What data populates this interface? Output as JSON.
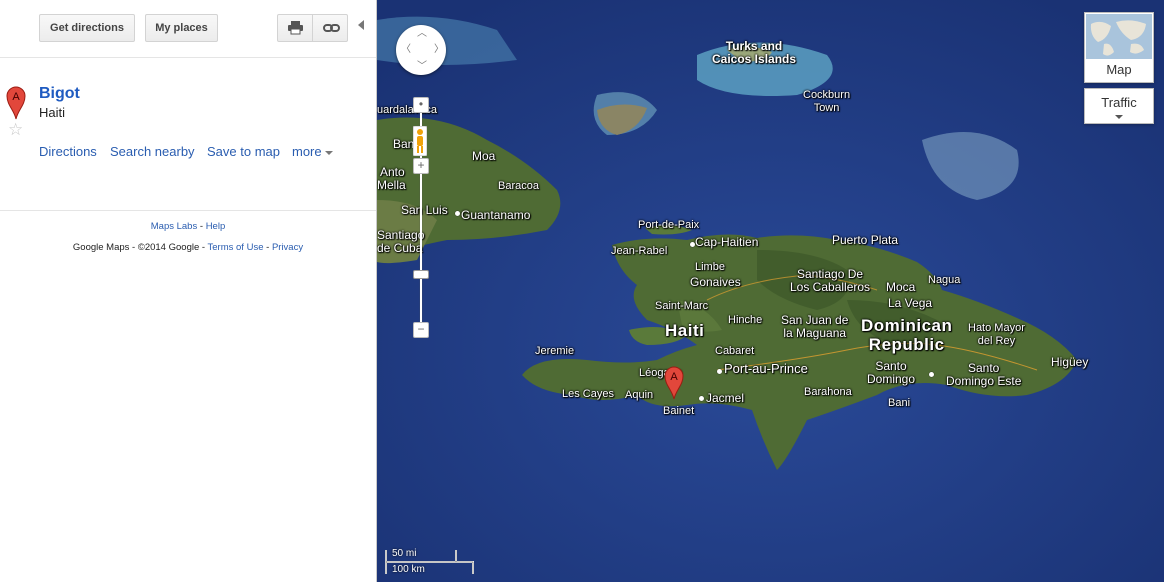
{
  "toolbar": {
    "get_directions": "Get directions",
    "my_places": "My places",
    "print_icon": "printer-icon",
    "link_icon": "link-icon"
  },
  "result": {
    "marker": "A",
    "title": "Bigot",
    "subtitle": "Haiti",
    "actions": {
      "directions": "Directions",
      "search_nearby": "Search nearby",
      "save_to_map": "Save to map",
      "more": "more"
    }
  },
  "footer": {
    "maps_labs": "Maps Labs",
    "sep1": " - ",
    "help": "Help",
    "copyright": "Google Maps - ©2014 Google - ",
    "terms": "Terms of Use",
    "sep2": " - ",
    "privacy": "Privacy"
  },
  "map_controls": {
    "map_type": "Map",
    "traffic": "Traffic",
    "scale_mi": "50 mi",
    "scale_km": "100 km",
    "zoom_in": "+",
    "zoom_out": "−"
  },
  "map_labels": {
    "turks_caicos": "Turks and\nCaicos Islands",
    "cockburn_town": "Cockburn\nTown",
    "guardalavaca": "uardalavaca",
    "banes": "Ban",
    "moa": "Moa",
    "antonio": "Anto",
    "mella": "Mella",
    "baracoa": "Baracoa",
    "san_luis": "San Luis",
    "guantanamo": "Guantanamo",
    "santiago_de_cuba": "Santiago\nde Cuba",
    "port_de_paix": "Port-de-Paix",
    "jean_rabel": "Jean-Rabel",
    "cap_haitien": "Cap-Haitien",
    "puerto_plata": "Puerto Plata",
    "limbe": "Limbe",
    "gonaives": "Gonaives",
    "santiago_de_los_caballeros": "Santiago De\nLos Caballeros",
    "nagua": "Nagua",
    "moca": "Moca",
    "la_vega": "La Vega",
    "saint_marc": "Saint-Marc",
    "hinche": "Hinche",
    "san_juan": "San Juan de\nla Maguana",
    "haiti": "Haiti",
    "dominican_republic": "Dominican\nRepublic",
    "hato_mayor": "Hato Mayor\ndel Rey",
    "jeremie": "Jeremie",
    "cabaret": "Cabaret",
    "leogane": "Léogane",
    "port_au_prince": "Port-au-Prince",
    "santo_domingo": "Santo\nDomingo",
    "santo_domingo_este": "Santo\nDomingo Este",
    "higuey": "Higüey",
    "les_cayes": "Les Cayes",
    "aquin": "Aquin",
    "bainet": "Bainet",
    "jacmel": "Jacmel",
    "barahona": "Barahona",
    "bani": "Bani"
  },
  "colors": {
    "link": "#1f5bc1",
    "ocean": "#1f3d83",
    "land": "#4f6b34",
    "marker": "#e2473b"
  }
}
